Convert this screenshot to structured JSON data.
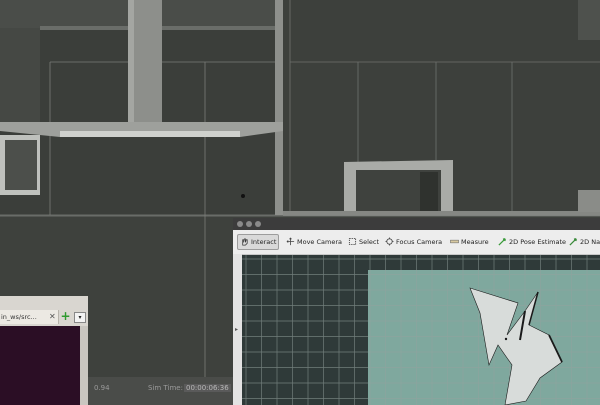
{
  "gazebo": {
    "status_value": "0.94",
    "sim_time_label": "Sim Time:",
    "sim_time_value": "00:00:06:36"
  },
  "terminal": {
    "tab_label": "in_ws/src...",
    "close_glyph": "✕",
    "new_tab_glyph": "+",
    "menu_glyph": "▾"
  },
  "rviz": {
    "tools": [
      {
        "label": "Interact",
        "icon": "cursor-hand-icon",
        "active": true
      },
      {
        "label": "Move Camera",
        "icon": "move-camera-icon"
      },
      {
        "label": "Select",
        "icon": "select-icon"
      },
      {
        "label": "Focus Camera",
        "icon": "focus-camera-icon"
      },
      {
        "label": "Measure",
        "icon": "measure-icon"
      },
      {
        "label": "2D Pose Estimate",
        "icon": "pose-estimate-icon"
      },
      {
        "label": "2D Nav",
        "icon": "nav-goal-icon"
      }
    ],
    "colors": {
      "map_free": "#7fa89e",
      "map_unknown": "#2f3a39",
      "grid": "#95a39f",
      "obstacle": "#1a1a1a",
      "scan": "#d8dcda"
    }
  }
}
